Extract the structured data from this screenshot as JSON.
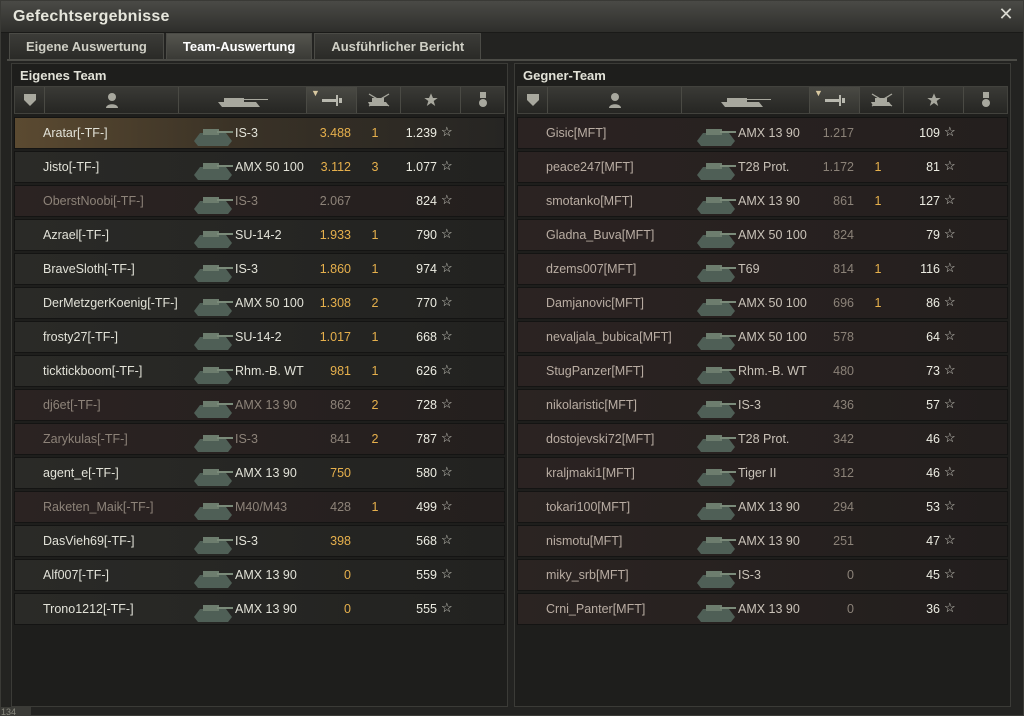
{
  "window": {
    "title": "Gefechtsergebnisse"
  },
  "tabs": [
    {
      "label": "Eigene Auswertung"
    },
    {
      "label": "Team-Auswertung"
    },
    {
      "label": "Ausführlicher Bericht"
    }
  ],
  "left": {
    "title": "Eigenes Team",
    "rows": [
      {
        "name": "Aratar[-TF-]",
        "tank": "IS-3",
        "dmg": "3.488",
        "kills": "1",
        "xp": "1.239"
      },
      {
        "name": "Jisto[-TF-]",
        "tank": "AMX 50 100",
        "dmg": "3.112",
        "kills": "3",
        "xp": "1.077"
      },
      {
        "name": "OberstNoobi[-TF-]",
        "tank": "IS-3",
        "dmg": "2.067",
        "kills": "",
        "xp": "824"
      },
      {
        "name": "Azrael[-TF-]",
        "tank": "SU-14-2",
        "dmg": "1.933",
        "kills": "1",
        "xp": "790"
      },
      {
        "name": "BraveSloth[-TF-]",
        "tank": "IS-3",
        "dmg": "1.860",
        "kills": "1",
        "xp": "974"
      },
      {
        "name": "DerMetzgerKoenig[-TF-]",
        "tank": "AMX 50 100",
        "dmg": "1.308",
        "kills": "2",
        "xp": "770"
      },
      {
        "name": "frosty27[-TF-]",
        "tank": "SU-14-2",
        "dmg": "1.017",
        "kills": "1",
        "xp": "668"
      },
      {
        "name": "ticktickboom[-TF-]",
        "tank": "Rhm.-B. WT",
        "dmg": "981",
        "kills": "1",
        "xp": "626"
      },
      {
        "name": "dj6et[-TF-]",
        "tank": "AMX 13 90",
        "dmg": "862",
        "kills": "2",
        "xp": "728"
      },
      {
        "name": "Zarykulas[-TF-]",
        "tank": "IS-3",
        "dmg": "841",
        "kills": "2",
        "xp": "787"
      },
      {
        "name": "agent_e[-TF-]",
        "tank": "AMX 13 90",
        "dmg": "750",
        "kills": "",
        "xp": "580"
      },
      {
        "name": "Raketen_Maik[-TF-]",
        "tank": "M40/M43",
        "dmg": "428",
        "kills": "1",
        "xp": "499"
      },
      {
        "name": "DasVieh69[-TF-]",
        "tank": "IS-3",
        "dmg": "398",
        "kills": "",
        "xp": "568"
      },
      {
        "name": "Alf007[-TF-]",
        "tank": "AMX 13 90",
        "dmg": "0",
        "kills": "",
        "xp": "559"
      },
      {
        "name": "Trono1212[-TF-]",
        "tank": "AMX 13 90",
        "dmg": "0",
        "kills": "",
        "xp": "555"
      }
    ]
  },
  "right": {
    "title": "Gegner-Team",
    "rows": [
      {
        "name": "Gisic[MFT]",
        "tank": "AMX 13 90",
        "dmg": "1.217",
        "kills": "",
        "xp": "109"
      },
      {
        "name": "peace247[MFT]",
        "tank": "T28 Prot.",
        "dmg": "1.172",
        "kills": "1",
        "xp": "81"
      },
      {
        "name": "smotanko[MFT]",
        "tank": "AMX 13 90",
        "dmg": "861",
        "kills": "1",
        "xp": "127"
      },
      {
        "name": "Gladna_Buva[MFT]",
        "tank": "AMX 50 100",
        "dmg": "824",
        "kills": "",
        "xp": "79"
      },
      {
        "name": "dzems007[MFT]",
        "tank": "T69",
        "dmg": "814",
        "kills": "1",
        "xp": "116"
      },
      {
        "name": "Damjanovic[MFT]",
        "tank": "AMX 50 100",
        "dmg": "696",
        "kills": "1",
        "xp": "86"
      },
      {
        "name": "nevaljala_bubica[MFT]",
        "tank": "AMX 50 100",
        "dmg": "578",
        "kills": "",
        "xp": "64"
      },
      {
        "name": "StugPanzer[MFT]",
        "tank": "Rhm.-B. WT",
        "dmg": "480",
        "kills": "",
        "xp": "73"
      },
      {
        "name": "nikolaristic[MFT]",
        "tank": "IS-3",
        "dmg": "436",
        "kills": "",
        "xp": "57"
      },
      {
        "name": "dostojevski72[MFT]",
        "tank": "T28 Prot.",
        "dmg": "342",
        "kills": "",
        "xp": "46"
      },
      {
        "name": "kraljmaki1[MFT]",
        "tank": "Tiger II",
        "dmg": "312",
        "kills": "",
        "xp": "46"
      },
      {
        "name": "tokari100[MFT]",
        "tank": "AMX 13 90",
        "dmg": "294",
        "kills": "",
        "xp": "53"
      },
      {
        "name": "nismotu[MFT]",
        "tank": "AMX 13 90",
        "dmg": "251",
        "kills": "",
        "xp": "47"
      },
      {
        "name": "miky_srb[MFT]",
        "tank": "IS-3",
        "dmg": "0",
        "kills": "",
        "xp": "45"
      },
      {
        "name": "Crni_Panter[MFT]",
        "tank": "AMX 13 90",
        "dmg": "0",
        "kills": "",
        "xp": "36"
      }
    ]
  },
  "corner_text": "134"
}
